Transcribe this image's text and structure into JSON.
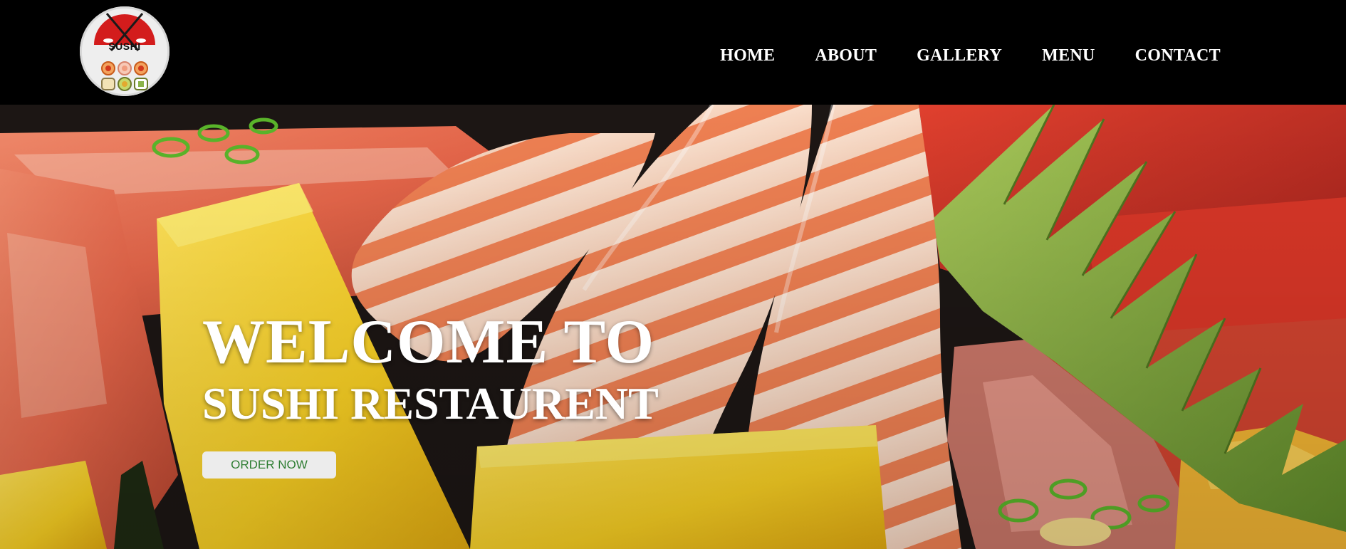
{
  "brand": {
    "logo_text": "SUSHI"
  },
  "nav": {
    "items": [
      {
        "label": "HOME"
      },
      {
        "label": "ABOUT"
      },
      {
        "label": "GALLERY"
      },
      {
        "label": "MENU"
      },
      {
        "label": "CONTACT"
      }
    ]
  },
  "hero": {
    "line1": "WELCOME TO",
    "line2": "SUSHI RESTAURENT",
    "cta_label": "ORDER NOW"
  },
  "colors": {
    "navbar_bg": "#000000",
    "text": "#ffffff",
    "button_bg": "#ececec",
    "button_text": "#2e7d32",
    "logo_red": "#d31c1c"
  }
}
